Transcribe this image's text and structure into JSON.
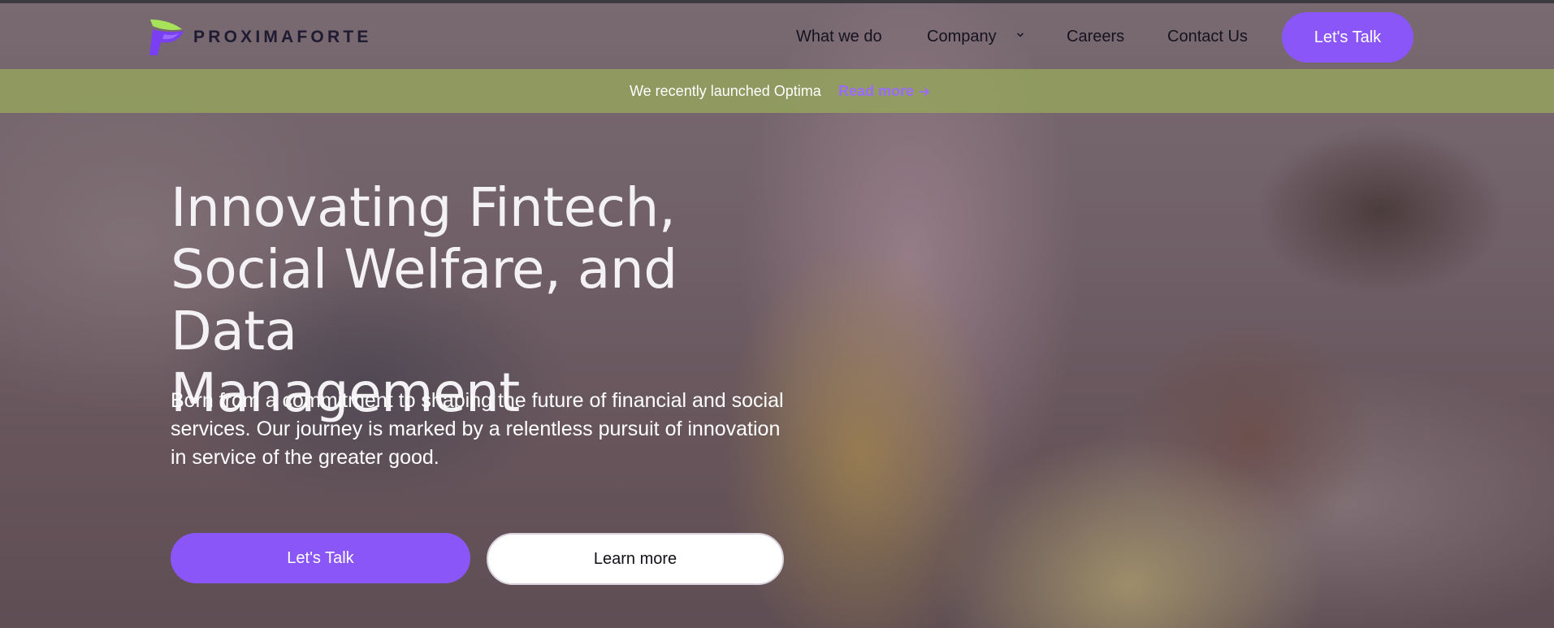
{
  "brand": {
    "name": "PROXIMAFORTE",
    "colors": {
      "accent": "#8a56f7",
      "logo_green": "#a6e35a",
      "logo_purple": "#7a3ff2",
      "announcement_bar": "#96a85c"
    }
  },
  "nav": {
    "items": [
      {
        "label": "What we do"
      },
      {
        "label": "Company",
        "icon": "chevron-down-icon"
      },
      {
        "label": "Careers"
      },
      {
        "label": "Contact Us"
      }
    ],
    "cta_label": "Let's Talk"
  },
  "announcement": {
    "text": "We recently launched Optima",
    "link_label": "Read more",
    "link_icon": "arrow-right-icon"
  },
  "hero": {
    "title_lines": [
      "Innovating Fintech,",
      "Social Welfare, and Data",
      "Management"
    ],
    "description": "Born from a commitment to shaping the future of financial and social services. Our journey is marked by a relentless pursuit of innovation in service of the greater good.",
    "primary_button": "Let's Talk",
    "secondary_button": "Learn more"
  }
}
